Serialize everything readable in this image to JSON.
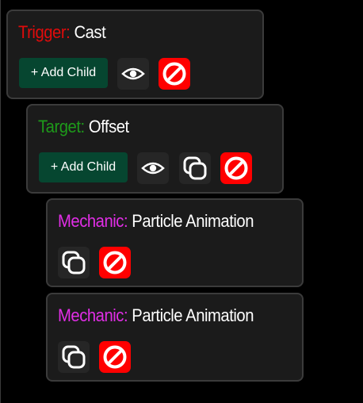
{
  "colors": {
    "trigger": "#e00b0b",
    "target": "#1e9a1a",
    "mechanic": "#e12ee6",
    "add_button_bg": "#064630",
    "delete_button_bg": "#ff0000"
  },
  "cards": [
    {
      "kind_label": "Trigger:",
      "name": "Cast",
      "add_child_label": "+ Add Child",
      "icons": [
        "eye-icon",
        "block-icon"
      ]
    },
    {
      "kind_label": "Target:",
      "name": "Offset",
      "add_child_label": "+ Add Child",
      "icons": [
        "eye-icon",
        "copy-icon",
        "block-icon"
      ]
    },
    {
      "kind_label": "Mechanic:",
      "name": "Particle Animation",
      "icons": [
        "copy-icon",
        "block-icon"
      ]
    },
    {
      "kind_label": "Mechanic:",
      "name": "Particle Animation",
      "icons": [
        "copy-icon",
        "block-icon"
      ]
    }
  ]
}
